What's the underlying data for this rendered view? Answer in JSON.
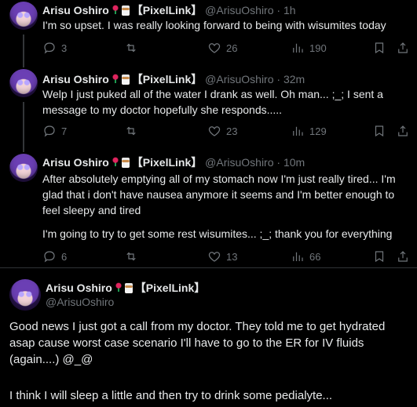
{
  "tweets": [
    {
      "name": "Arisu Oshiro",
      "badge": "【PixelLink】",
      "handle_time": "@ArisuOshiro · 1h",
      "text": "I'm so upset. I was really looking forward to being with wisumites today",
      "replies": "3",
      "likes": "26",
      "views": "190"
    },
    {
      "name": "Arisu Oshiro",
      "badge": "【PixelLink】",
      "handle_time": "@ArisuOshiro · 32m",
      "text": "Welp I just puked all of the water I drank as well. Oh man... ;_; I sent a message to my doctor hopefully she responds.....",
      "replies": "7",
      "likes": "23",
      "views": "129"
    },
    {
      "name": "Arisu Oshiro",
      "badge": "【PixelLink】",
      "handle_time": "@ArisuOshiro · 10m",
      "text1": "After absolutely emptying all of my stomach now I'm just really tired... I'm glad that i don't have nausea anymore it seems and I'm better enough to feel sleepy and tired",
      "text2": "I'm going to try to get some rest wisumites... ;_; thank you for everything",
      "replies": "6",
      "likes": "13",
      "views": "66"
    }
  ],
  "main": {
    "name": "Arisu Oshiro",
    "badge": "【PixelLink】",
    "handle": "@ArisuOshiro",
    "text1": "Good news I just got a call from my doctor. They told me to get hydrated asap cause worst case scenario I'll have to go to the ER for IV fluids (again....) @_@",
    "text2": "I think I will sleep a little and then try to drink some pedialyte..."
  },
  "icons": [
    "reply-icon",
    "retweet-icon",
    "like-icon",
    "views-icon",
    "bookmark-icon",
    "share-icon"
  ]
}
